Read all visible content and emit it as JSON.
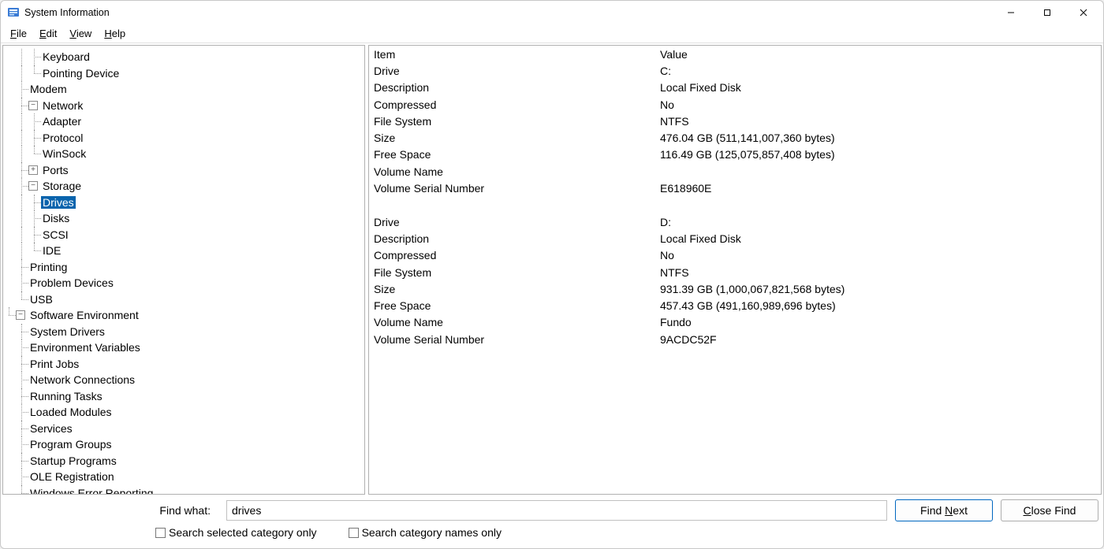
{
  "window": {
    "title": "System Information"
  },
  "menu": {
    "file": "File",
    "edit": "Edit",
    "view": "View",
    "help": "Help"
  },
  "tree": {
    "keyboard": "Keyboard",
    "pointing_device": "Pointing Device",
    "modem": "Modem",
    "network": "Network",
    "adapter": "Adapter",
    "protocol": "Protocol",
    "winsock": "WinSock",
    "ports": "Ports",
    "storage": "Storage",
    "drives": "Drives",
    "disks": "Disks",
    "scsi": "SCSI",
    "ide": "IDE",
    "printing": "Printing",
    "problem_devices": "Problem Devices",
    "usb": "USB",
    "software_env": "Software Environment",
    "system_drivers": "System Drivers",
    "env_vars": "Environment Variables",
    "print_jobs": "Print Jobs",
    "net_conn": "Network Connections",
    "running_tasks": "Running Tasks",
    "loaded_modules": "Loaded Modules",
    "services": "Services",
    "program_groups": "Program Groups",
    "startup_programs": "Startup Programs",
    "ole_reg": "OLE Registration",
    "win_err": "Windows Error Reporting"
  },
  "table": {
    "header_item": "Item",
    "header_value": "Value",
    "rows": [
      {
        "k": "Drive",
        "v": "C:"
      },
      {
        "k": "Description",
        "v": "Local Fixed Disk"
      },
      {
        "k": "Compressed",
        "v": "No"
      },
      {
        "k": "File System",
        "v": "NTFS"
      },
      {
        "k": "Size",
        "v": "476.04 GB (511,141,007,360 bytes)"
      },
      {
        "k": "Free Space",
        "v": "116.49 GB (125,075,857,408 bytes)"
      },
      {
        "k": "Volume Name",
        "v": ""
      },
      {
        "k": "Volume Serial Number",
        "v": "E618960E"
      },
      {
        "k": "",
        "v": ""
      },
      {
        "k": "Drive",
        "v": "D:"
      },
      {
        "k": "Description",
        "v": "Local Fixed Disk"
      },
      {
        "k": "Compressed",
        "v": "No"
      },
      {
        "k": "File System",
        "v": "NTFS"
      },
      {
        "k": "Size",
        "v": "931.39 GB (1,000,067,821,568 bytes)"
      },
      {
        "k": "Free Space",
        "v": "457.43 GB (491,160,989,696 bytes)"
      },
      {
        "k": "Volume Name",
        "v": "Fundo"
      },
      {
        "k": "Volume Serial Number",
        "v": "9ACDC52F"
      }
    ]
  },
  "find": {
    "label": "Find what:",
    "value": "drives",
    "find_next": "Find Next",
    "close_find": "Close Find",
    "chk_selected": "Search selected category only",
    "chk_names": "Search category names only"
  }
}
